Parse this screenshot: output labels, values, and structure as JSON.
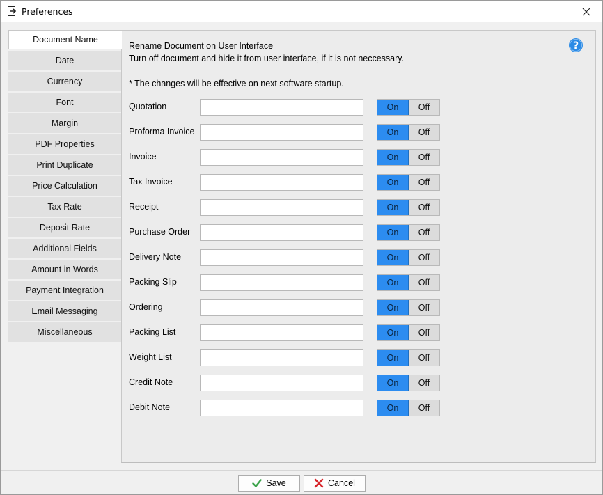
{
  "window": {
    "title": "Preferences"
  },
  "sidebar": {
    "items": [
      {
        "label": "Document Name",
        "active": true
      },
      {
        "label": "Date"
      },
      {
        "label": "Currency"
      },
      {
        "label": "Font"
      },
      {
        "label": "Margin"
      },
      {
        "label": "PDF Properties"
      },
      {
        "label": "Print Duplicate"
      },
      {
        "label": "Price Calculation"
      },
      {
        "label": "Tax Rate"
      },
      {
        "label": "Deposit Rate"
      },
      {
        "label": "Additional Fields"
      },
      {
        "label": "Amount in Words"
      },
      {
        "label": "Payment Integration"
      },
      {
        "label": "Email Messaging"
      },
      {
        "label": "Miscellaneous"
      }
    ]
  },
  "panel": {
    "heading": "Rename Document on User Interface",
    "subheading": "Turn off document and hide it from user interface, if it is not neccessary.",
    "note": "* The changes will be effective on next software startup.",
    "on_label": "On",
    "off_label": "Off",
    "rows": [
      {
        "label": "Quotation",
        "value": "",
        "state": "On"
      },
      {
        "label": "Proforma Invoice",
        "value": "",
        "state": "On"
      },
      {
        "label": "Invoice",
        "value": "",
        "state": "On"
      },
      {
        "label": "Tax Invoice",
        "value": "",
        "state": "On"
      },
      {
        "label": "Receipt",
        "value": "",
        "state": "On"
      },
      {
        "label": "Purchase Order",
        "value": "",
        "state": "On"
      },
      {
        "label": "Delivery Note",
        "value": "",
        "state": "On"
      },
      {
        "label": "Packing Slip",
        "value": "",
        "state": "On"
      },
      {
        "label": "Ordering",
        "value": "",
        "state": "On"
      },
      {
        "label": "Packing List",
        "value": "",
        "state": "On"
      },
      {
        "label": "Weight List",
        "value": "",
        "state": "On"
      },
      {
        "label": "Credit Note",
        "value": "",
        "state": "On"
      },
      {
        "label": "Debit Note",
        "value": "",
        "state": "On"
      }
    ]
  },
  "footer": {
    "save_label": "Save",
    "cancel_label": "Cancel"
  },
  "colors": {
    "on_active": "#2c8cf0",
    "off_inactive": "#dcdcdc",
    "help": "#2b8be6",
    "save_check": "#3aa34a",
    "cancel_x": "#d7262b"
  }
}
